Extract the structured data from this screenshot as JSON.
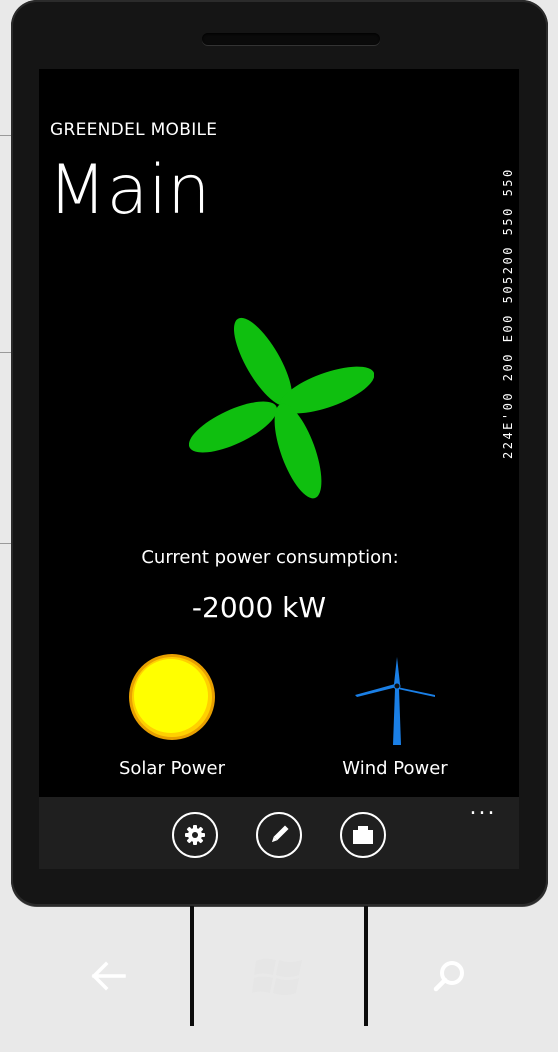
{
  "app": {
    "app_title": "GREENDEL MOBILE",
    "page_title": "Main",
    "side_readout": "224E'00 200 E00 505200 550 550"
  },
  "consumption": {
    "label": "Current power consumption:",
    "value": "-2000 kW"
  },
  "sources": [
    {
      "label": "Solar Power",
      "icon": "sun-icon"
    },
    {
      "label": "Wind Power",
      "icon": "wind-turbine-icon"
    }
  ],
  "app_bar": {
    "buttons": [
      {
        "icon": "settings-gear-icon"
      },
      {
        "icon": "edit-pencil-icon"
      },
      {
        "icon": "folder-icon"
      }
    ],
    "more": "..."
  },
  "hardware": {
    "buttons": [
      {
        "icon": "back-arrow-icon"
      },
      {
        "icon": "windows-start-icon"
      },
      {
        "icon": "search-icon"
      }
    ]
  },
  "colors": {
    "leaf_green": "#0fbf0f",
    "sun_yellow": "#ffff00",
    "sun_orange": "#f0a000",
    "wind_blue": "#1a7fe6",
    "screen_bg": "#000000",
    "appbar_bg": "#1f1f1f"
  }
}
